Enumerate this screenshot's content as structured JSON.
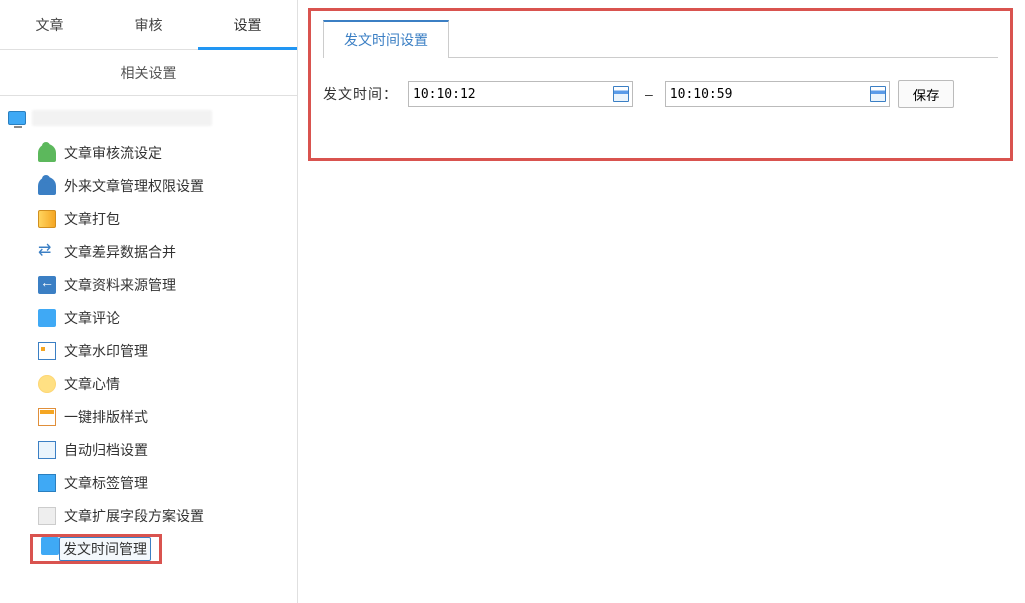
{
  "tabs": {
    "items": [
      "文章",
      "审核",
      "设置"
    ],
    "active": 2
  },
  "section_title": "相关设置",
  "tree": {
    "items": [
      {
        "icon": "ic-user-green",
        "label": "文章审核流设定"
      },
      {
        "icon": "ic-user-blue",
        "label": "外来文章管理权限设置"
      },
      {
        "icon": "ic-pack",
        "label": "文章打包"
      },
      {
        "icon": "ic-sync",
        "label": "文章差异数据合并"
      },
      {
        "icon": "ic-back",
        "label": "文章资料来源管理"
      },
      {
        "icon": "ic-keyboard",
        "label": "文章评论"
      },
      {
        "icon": "ic-watermark",
        "label": "文章水印管理"
      },
      {
        "icon": "ic-mood",
        "label": "文章心情"
      },
      {
        "icon": "ic-layout",
        "label": "一键排版样式"
      },
      {
        "icon": "ic-archive",
        "label": "自动归档设置"
      },
      {
        "icon": "ic-tag",
        "label": "文章标签管理"
      },
      {
        "icon": "ic-ext",
        "label": "文章扩展字段方案设置"
      },
      {
        "icon": "ic-time",
        "label": "发文时间管理",
        "selected": true
      }
    ]
  },
  "panel": {
    "tab_label": "发文时间设置",
    "row_label": "发文时间：",
    "time_start": "10:10:12",
    "dash": "–",
    "time_end": "10:10:59",
    "save_label": "保存"
  }
}
